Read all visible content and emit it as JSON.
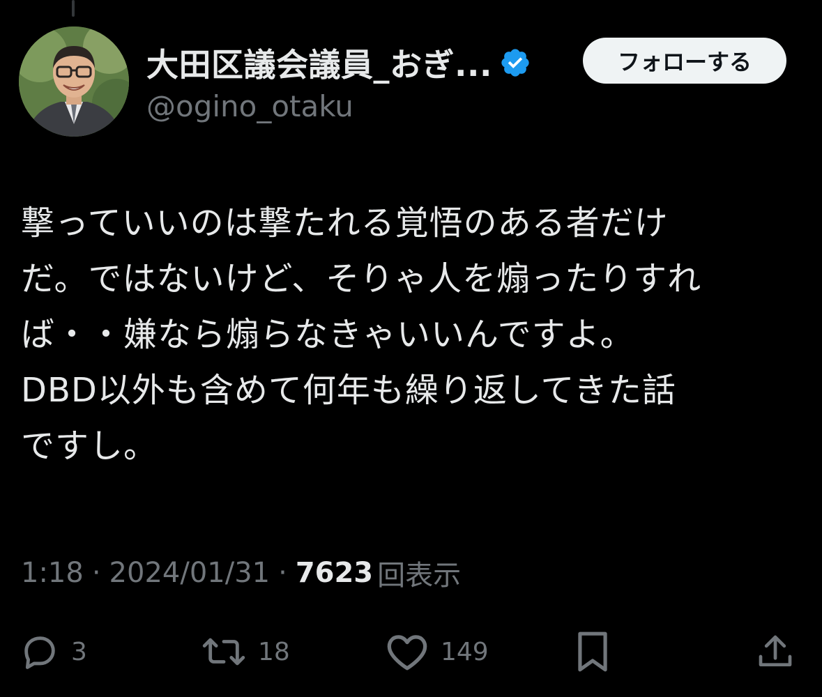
{
  "author": {
    "display_name": "大田区議会議員_おぎ...",
    "handle": "@ogino_otaku",
    "verified_icon": "verified-badge-icon",
    "badge_color": "#1d9bf0"
  },
  "follow_button": {
    "label": "フォローする"
  },
  "tweet": {
    "text": "撃っていいのは撃たれる覚悟のある者だけ\nだ。ではないけど、そりゃ人を煽ったりすれ\nば・・嫌なら煽らなきゃいいんですよ。\nDBD以外も含めて何年も繰り返してきた話\nですし。",
    "time": "1:18",
    "separator": "·",
    "date": "2024/01/31",
    "views_count": "7623",
    "views_label": "回表示"
  },
  "actions": {
    "reply": {
      "icon": "reply-icon",
      "count": "3"
    },
    "retweet": {
      "icon": "retweet-icon",
      "count": "18"
    },
    "like": {
      "icon": "heart-icon",
      "count": "149"
    },
    "bookmark": {
      "icon": "bookmark-icon"
    },
    "share": {
      "icon": "share-icon"
    }
  },
  "colors": {
    "background": "#000000",
    "text_primary": "#e7e9ea",
    "text_secondary": "#71767b",
    "follow_button_bg": "#eff3f4"
  }
}
